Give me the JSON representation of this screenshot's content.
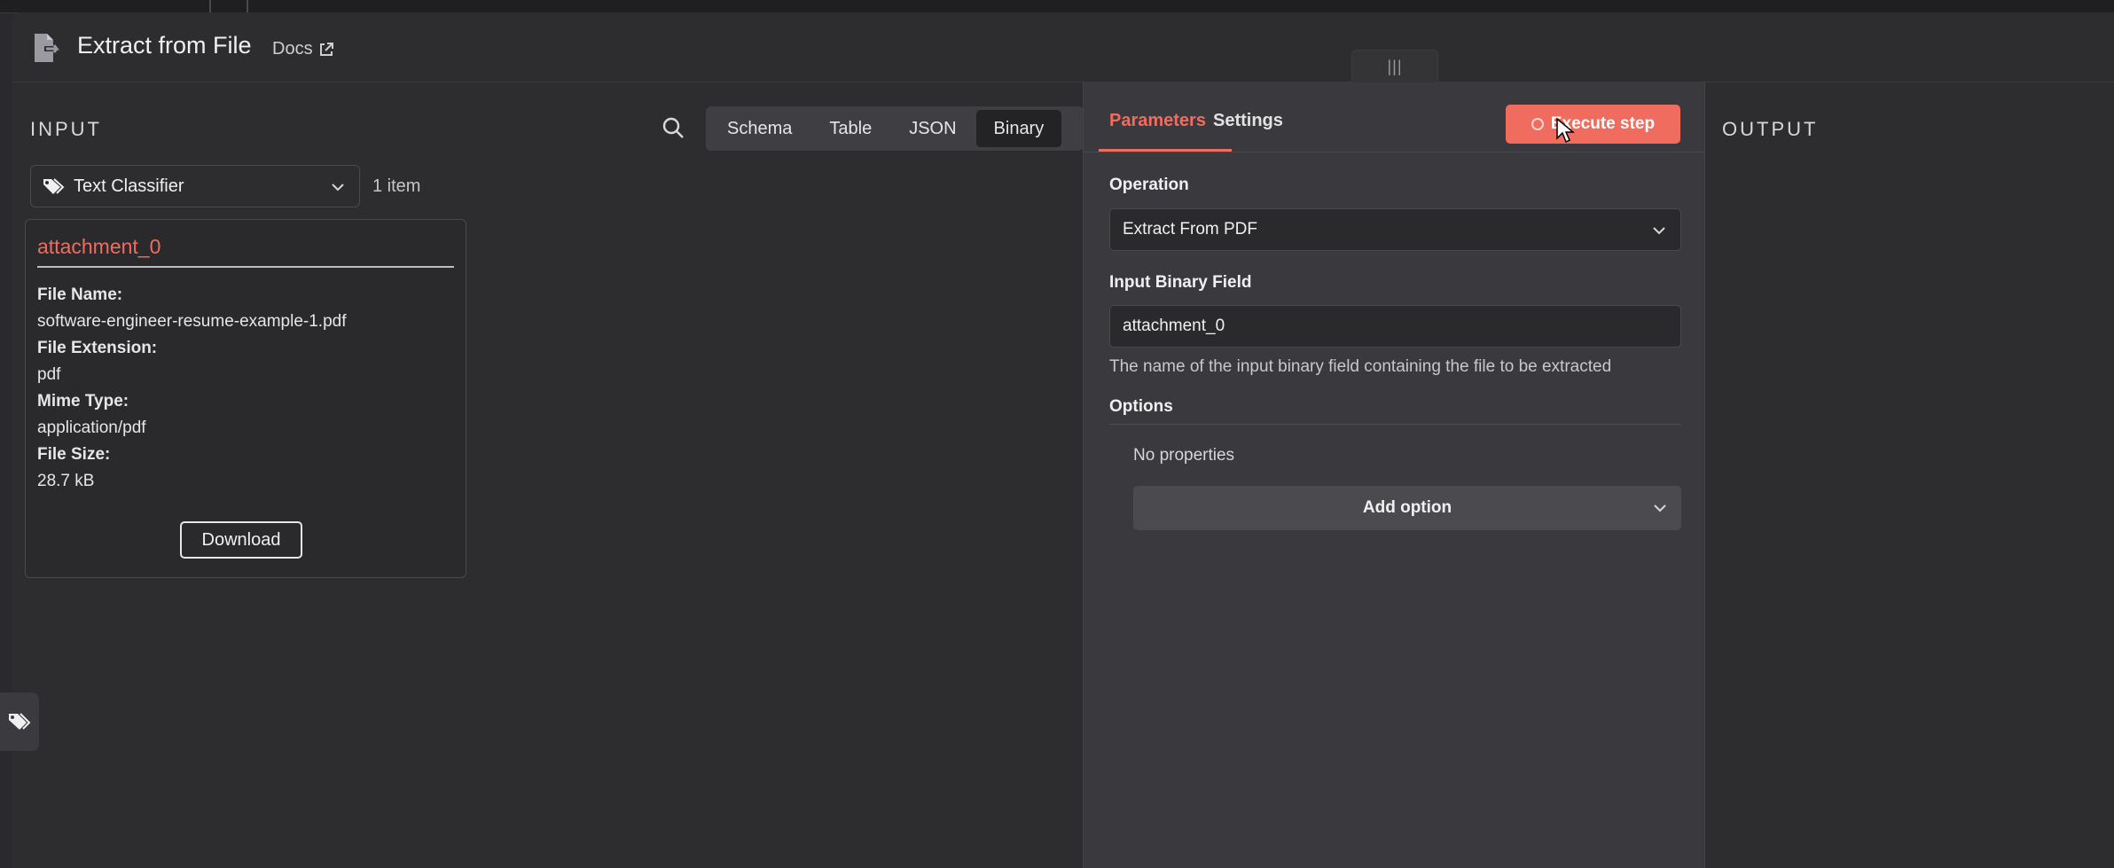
{
  "header": {
    "title": "Extract from File",
    "docs_label": "Docs"
  },
  "input": {
    "label": "INPUT",
    "view_tabs": [
      "Schema",
      "Table",
      "JSON",
      "Binary"
    ],
    "active_tab": "Binary",
    "source_node": "Text Classifier",
    "item_count": "1 item",
    "binary_card": {
      "name": "attachment_0",
      "fields": [
        {
          "key": "File Name:",
          "value": "software-engineer-resume-example-1.pdf"
        },
        {
          "key": "File Extension:",
          "value": "pdf"
        },
        {
          "key": "Mime Type:",
          "value": "application/pdf"
        },
        {
          "key": "File Size:",
          "value": "28.7 kB"
        }
      ],
      "download_label": "Download"
    }
  },
  "params": {
    "tabs": [
      "Parameters",
      "Settings"
    ],
    "active_tab": "Parameters",
    "execute_label": "Execute step",
    "operation_label": "Operation",
    "operation_value": "Extract From PDF",
    "binary_field_label": "Input Binary Field",
    "binary_field_value": "attachment_0",
    "binary_field_hint": "The name of the input binary field containing the file to be extracted",
    "options_label": "Options",
    "no_properties": "No properties",
    "add_option_label": "Add option"
  },
  "output": {
    "label": "OUTPUT"
  },
  "icons": [
    "file-export-icon",
    "external-link-icon",
    "drag-handle-icon",
    "search-icon",
    "tag-icon",
    "chevron-down-icon",
    "spinner-icon",
    "cursor-icon"
  ],
  "colors": {
    "accent": "#ef6c5e",
    "background": "#2d2d30",
    "params_bg": "#3a3a3e"
  }
}
